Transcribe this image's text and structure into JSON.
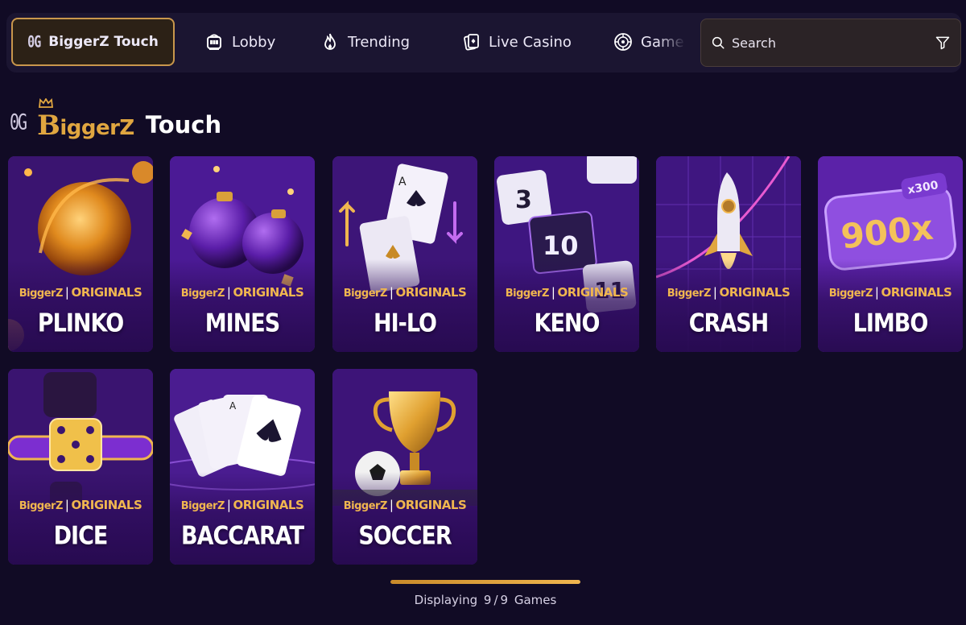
{
  "nav": {
    "active": {
      "og": "0G",
      "label": "BiggerZ Touch"
    },
    "items": [
      {
        "label": "Lobby",
        "icon": "slot-machine-icon"
      },
      {
        "label": "Trending",
        "icon": "flame-icon"
      },
      {
        "label": "Live Casino",
        "icon": "cards-icon"
      },
      {
        "label": "Game",
        "icon": "roulette-icon"
      }
    ],
    "search": {
      "placeholder": "Search"
    }
  },
  "section": {
    "og": "0G",
    "brand": "BiggerZ",
    "brand_initial": "B",
    "brand_rest": "iggerZ",
    "title": "Touch"
  },
  "originals_label": {
    "brand_initial": "B",
    "brand_rest": "iggerZ",
    "separator": "|",
    "suffix": "ORIGINALS"
  },
  "games": [
    {
      "name": "PLINKO"
    },
    {
      "name": "MINES"
    },
    {
      "name": "HI-LO"
    },
    {
      "name": "KENO"
    },
    {
      "name": "CRASH"
    },
    {
      "name": "LIMBO"
    },
    {
      "name": "DICE"
    },
    {
      "name": "BACCARAT"
    },
    {
      "name": "SOCCER"
    }
  ],
  "art_text": {
    "hilo_card_rank": "A",
    "keno_numbers": [
      "3",
      "10",
      "11"
    ],
    "limbo_multiplier": "900x",
    "limbo_badge": "x300",
    "baccarat_rank": "A"
  },
  "footer": {
    "prefix": "Displaying",
    "shown": "9",
    "separator": "/",
    "total": "9",
    "suffix": "Games",
    "progress": 1.0
  },
  "colors": {
    "background": "#110b25",
    "accent_gold": "#f0b64f",
    "card_purple": "#6a2ab8"
  }
}
